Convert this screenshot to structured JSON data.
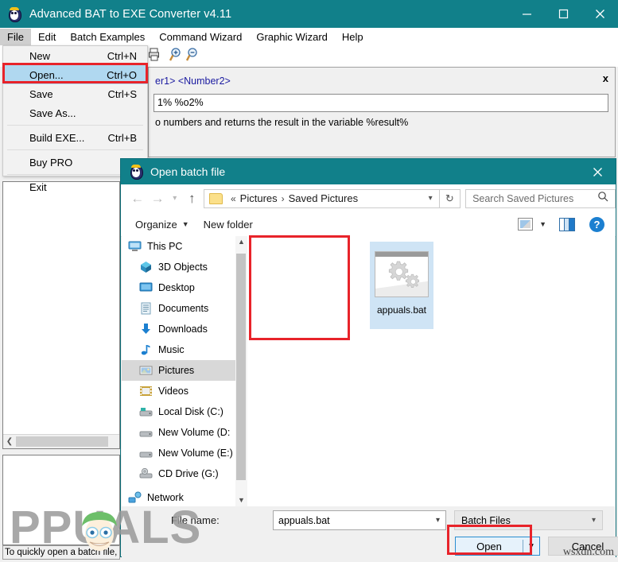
{
  "app": {
    "title": "Advanced BAT to EXE Converter v4.11",
    "icon": "app-mascot-icon",
    "window_buttons": {
      "minimize": "minimize-icon",
      "maximize": "maximize-icon",
      "close": "close-icon"
    },
    "menubar": [
      {
        "label": "File",
        "active": true
      },
      {
        "label": "Edit",
        "active": false
      },
      {
        "label": "Batch Examples",
        "active": false
      },
      {
        "label": "Command Wizard",
        "active": false
      },
      {
        "label": "Graphic Wizard",
        "active": false
      },
      {
        "label": "Help",
        "active": false
      }
    ],
    "toolbar": [
      {
        "name": "print-icon"
      },
      {
        "name": "zoom-in-icon"
      },
      {
        "name": "zoom-out-icon"
      }
    ],
    "status_text": "To quickly open a batch file, d"
  },
  "file_menu": {
    "items": [
      {
        "label": "New",
        "accel": "Ctrl+N",
        "selected": false,
        "separator_after": false
      },
      {
        "label": "Open...",
        "accel": "Ctrl+O",
        "selected": true,
        "separator_after": false
      },
      {
        "label": "Save",
        "accel": "Ctrl+S",
        "selected": false,
        "separator_after": false
      },
      {
        "label": "Save As...",
        "accel": "",
        "selected": false,
        "separator_after": true
      },
      {
        "label": "Build EXE...",
        "accel": "Ctrl+B",
        "selected": false,
        "separator_after": true
      },
      {
        "label": "Buy PRO",
        "accel": "",
        "selected": false,
        "separator_after": true
      },
      {
        "label": "Exit",
        "accel": "",
        "selected": false,
        "separator_after": false
      }
    ],
    "highlight_color": "#e8232a"
  },
  "background_panel": {
    "hint": "er1> <Number2>",
    "close_label": "x",
    "input_value": "1% %o2%",
    "description": "o numbers and returns the result in the variable %result%"
  },
  "dialog": {
    "title": "Open batch file",
    "icon": "app-mascot-icon",
    "close_icon": "close-icon",
    "nav": {
      "back_icon": "arrow-left-icon",
      "forward_icon": "arrow-right-icon",
      "recent_icon": "chevron-down-icon",
      "up_icon": "arrow-up-icon",
      "breadcrumb_prefix": "«",
      "breadcrumbs": [
        "Pictures",
        "Saved Pictures"
      ],
      "breadcrumb_separator": "›",
      "address_caret": "chevron-down-icon",
      "refresh_icon": "refresh-icon"
    },
    "search": {
      "placeholder": "Search Saved Pictures",
      "icon": "search-icon"
    },
    "commandbar": {
      "organize": "Organize",
      "organize_caret": "caret-down-icon",
      "new_folder": "New folder",
      "view_icon": "view-layout-icon",
      "view_caret": "caret-down-icon",
      "preview_pane_icon": "preview-pane-icon",
      "help_icon": "help-icon",
      "help_label": "?"
    },
    "nav_pane": {
      "items": [
        {
          "label": "This PC",
          "icon": "computer-icon",
          "indent": false,
          "selected": false
        },
        {
          "label": "3D Objects",
          "icon": "3d-objects-icon",
          "indent": true,
          "selected": false
        },
        {
          "label": "Desktop",
          "icon": "desktop-icon",
          "indent": true,
          "selected": false
        },
        {
          "label": "Documents",
          "icon": "documents-icon",
          "indent": true,
          "selected": false
        },
        {
          "label": "Downloads",
          "icon": "downloads-icon",
          "indent": true,
          "selected": false
        },
        {
          "label": "Music",
          "icon": "music-icon",
          "indent": true,
          "selected": false
        },
        {
          "label": "Pictures",
          "icon": "pictures-icon",
          "indent": true,
          "selected": true
        },
        {
          "label": "Videos",
          "icon": "videos-icon",
          "indent": true,
          "selected": false
        },
        {
          "label": "Local Disk (C:)",
          "icon": "harddisk-icon",
          "indent": true,
          "selected": false
        },
        {
          "label": "New Volume (D:",
          "icon": "drive-icon",
          "indent": true,
          "selected": false
        },
        {
          "label": "New Volume (E:)",
          "icon": "drive-icon",
          "indent": true,
          "selected": false
        },
        {
          "label": "CD Drive (G:)",
          "icon": "cd-drive-icon",
          "indent": true,
          "selected": false
        },
        {
          "label": "Network",
          "icon": "network-icon",
          "indent": false,
          "selected": false
        }
      ],
      "scroll_up_icon": "chevron-up-icon",
      "scroll_down_icon": "chevron-down-icon"
    },
    "files": [
      {
        "name": "appuals.bat",
        "icon": "gears-thumbnail-icon",
        "selected": true,
        "highlighted": true
      }
    ],
    "footer": {
      "filename_label": "File name:",
      "filename_value": "appuals.bat",
      "filename_caret": "chevron-down-icon",
      "filter_value": "Batch Files",
      "filter_caret": "chevron-down-icon",
      "open_label": "Open",
      "open_caret": "caret-down-icon",
      "cancel_label": "Cancel",
      "open_highlight_color": "#e8232a"
    }
  },
  "watermarks": {
    "appuals": "PPUALS",
    "wsxdn": "wsxdn.com"
  },
  "colors": {
    "titlebar_teal": "#11808a",
    "menu_selected": "#b0d8f0",
    "red_highlight": "#e8232a",
    "file_selected": "#cfe4f5"
  }
}
